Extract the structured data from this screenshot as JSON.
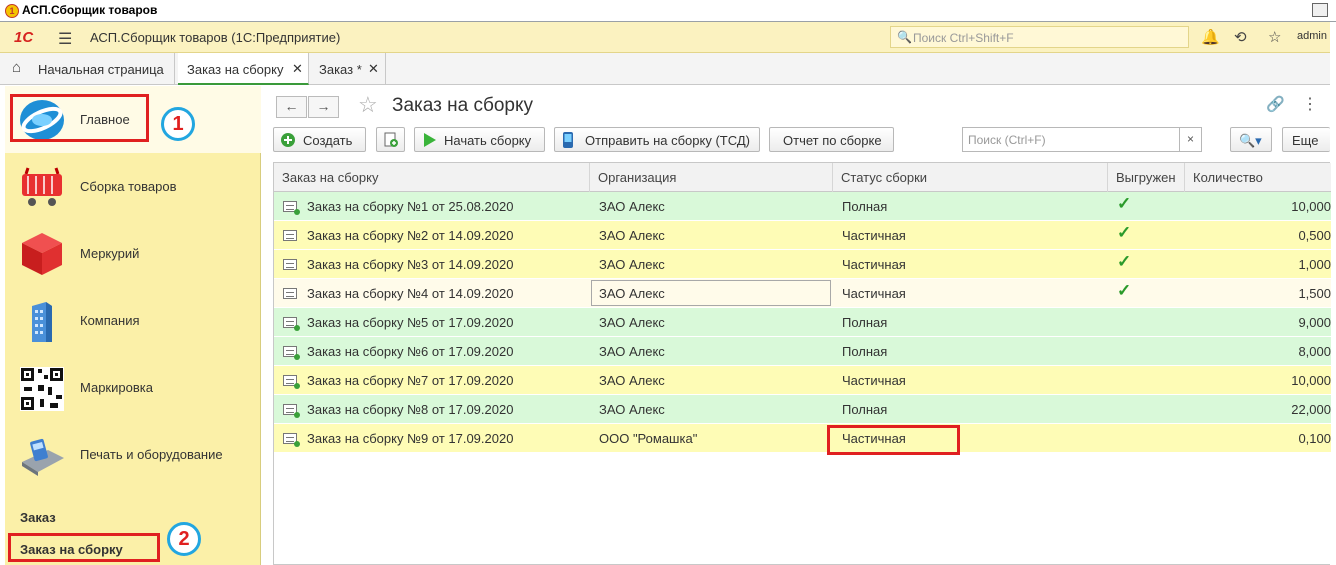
{
  "window": {
    "title": "АСП.Сборщик товаров"
  },
  "header": {
    "app_title": "АСП.Сборщик товаров  (1С:Предприятие)",
    "search_placeholder": "Поиск Ctrl+Shift+F",
    "user": "admin"
  },
  "tabs": [
    {
      "label": "Начальная страница"
    },
    {
      "label": "Заказ на сборку"
    },
    {
      "label": "Заказ *"
    }
  ],
  "sidebar": {
    "sections": [
      {
        "label": "Главное",
        "icon": "globe-icon"
      },
      {
        "label": "Сборка товаров",
        "icon": "basket-icon"
      },
      {
        "label": "Меркурий",
        "icon": "cube-icon"
      },
      {
        "label": "Компания",
        "icon": "building-icon"
      },
      {
        "label": "Маркировка",
        "icon": "qr-code-icon"
      },
      {
        "label": "Печать и оборудование",
        "icon": "terminal-icon"
      }
    ],
    "group_header": "Заказ",
    "group_item": "Заказ на сборку",
    "annotations": [
      "1",
      "2"
    ]
  },
  "form": {
    "title": "Заказ на сборку",
    "buttons": {
      "create": "Создать",
      "start": "Начать сборку",
      "send": "Отправить на сборку (ТСД)",
      "report": "Отчет по сборке",
      "more": "Еще"
    },
    "search_placeholder": "Поиск (Ctrl+F)"
  },
  "table": {
    "columns": [
      "Заказ на сборку",
      "Организация",
      "Статус сборки",
      "Выгружен",
      "Количество"
    ],
    "rows": [
      {
        "name": "Заказ на сборку №1 от 25.08.2020",
        "org": "ЗАО Алекс",
        "status": "Полная",
        "exported": "✓",
        "qty": "10,000",
        "color": "green"
      },
      {
        "name": "Заказ на сборку №2 от 14.09.2020",
        "org": "ЗАО Алекс",
        "status": "Частичная",
        "exported": "✓",
        "qty": "0,500",
        "color": "yellow"
      },
      {
        "name": "Заказ на сборку №3 от 14.09.2020",
        "org": "ЗАО Алекс",
        "status": "Частичная",
        "exported": "✓",
        "qty": "1,000",
        "color": "yellow"
      },
      {
        "name": "Заказ на сборку №4 от 14.09.2020",
        "org": "ЗАО Алекс",
        "status": "Частичная",
        "exported": "✓",
        "qty": "1,500",
        "color": "selected"
      },
      {
        "name": "Заказ на сборку №5 от 17.09.2020",
        "org": "ЗАО Алекс",
        "status": "Полная",
        "exported": "",
        "qty": "9,000",
        "color": "green"
      },
      {
        "name": "Заказ на сборку №6 от 17.09.2020",
        "org": "ЗАО Алекс",
        "status": "Полная",
        "exported": "",
        "qty": "8,000",
        "color": "green"
      },
      {
        "name": "Заказ на сборку №7 от 17.09.2020",
        "org": "ЗАО Алекс",
        "status": "Частичная",
        "exported": "",
        "qty": "10,000",
        "color": "yellow"
      },
      {
        "name": "Заказ на сборку №8 от 17.09.2020",
        "org": "ЗАО Алекс",
        "status": "Полная",
        "exported": "",
        "qty": "22,000",
        "color": "green"
      },
      {
        "name": "Заказ на сборку №9 от 17.09.2020",
        "org": "ООО \"Ромашка\"",
        "status": "Частичная",
        "exported": "",
        "qty": "0,100",
        "color": "yellow"
      }
    ]
  },
  "colors": {
    "green_row": "#d9f9d9",
    "yellow_row": "#fefcb6",
    "highlight": "#e02020",
    "callout": "#22a6e0"
  }
}
